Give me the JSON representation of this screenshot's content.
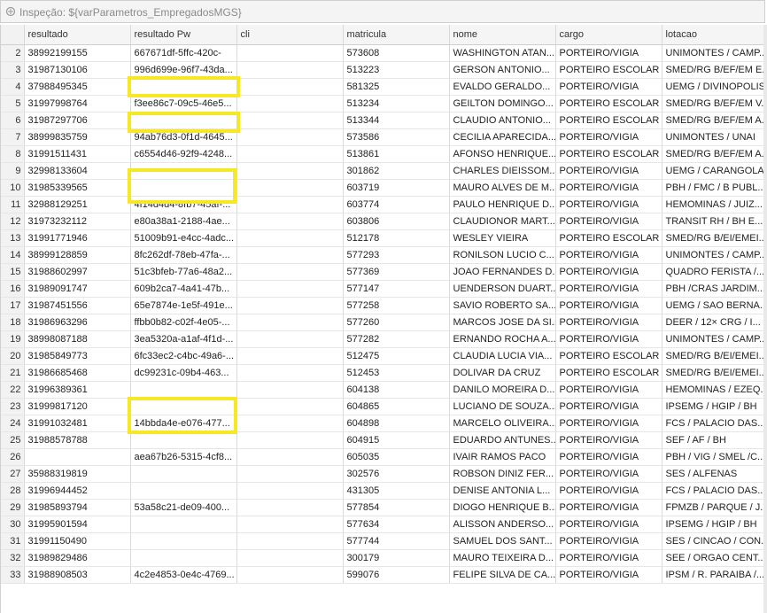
{
  "window": {
    "title": "Inspeção: ${varParametros_EmpregadosMGS}"
  },
  "columns": [
    "",
    "resultado",
    "resultado Pw",
    "cli",
    "matricula",
    "nome",
    "cargo",
    "lotacao"
  ],
  "rows": [
    [
      "2",
      "38992199155",
      "667671df-5ffc-420c-",
      "",
      "573608",
      "WASHINGTON ATAN...",
      "PORTEIRO/VIGIA",
      "UNIMONTES / CAMP..."
    ],
    [
      "3",
      "31987130106",
      "996d699e-96f7-43da...",
      "",
      "513223",
      "GERSON ANTONIO...",
      "PORTEIRO ESCOLAR",
      "SMED/RG B/EF/EM E..."
    ],
    [
      "4",
      "37988495345",
      "",
      "",
      "581325",
      "EVALDO GERALDO...",
      "PORTEIRO/VIGIA",
      "UEMG / DIVINOPOLIS"
    ],
    [
      "5",
      "31997998764",
      "f3ee86c7-09c5-46e5...",
      "",
      "513234",
      "GEILTON DOMINGO...",
      "PORTEIRO ESCOLAR",
      "SMED/RG B/EF/EM V..."
    ],
    [
      "6",
      "31987297706",
      "",
      "",
      "513344",
      "CLAUDIO ANTONIO...",
      "PORTEIRO ESCOLAR",
      "SMED/RG B/EF/EM A..."
    ],
    [
      "7",
      "38999835759",
      "94ab76d3-0f1d-4645...",
      "",
      "573586",
      "CECILIA APARECIDA...",
      "PORTEIRO/VIGIA",
      "UNIMONTES / UNAI"
    ],
    [
      "8",
      "31991511431",
      "c6554d46-92f9-4248...",
      "",
      "513861",
      "AFONSO HENRIQUE...",
      "PORTEIRO ESCOLAR",
      "SMED/RG B/EF/EM A..."
    ],
    [
      "9",
      "32998133604",
      "",
      "",
      "301862",
      "CHARLES DIEISSOM...",
      "PORTEIRO/VIGIA",
      "UEMG / CARANGOLA"
    ],
    [
      "10",
      "31985339565",
      "",
      "",
      "603719",
      "MAURO ALVES DE M...",
      "PORTEIRO/VIGIA",
      "PBH / FMC / B PUBL..."
    ],
    [
      "11",
      "32988129251",
      "4f14d4d4-8fb7-45af-...",
      "",
      "603774",
      "PAULO HENRIQUE D...",
      "PORTEIRO/VIGIA",
      "HEMOMINAS / JUIZ..."
    ],
    [
      "12",
      "31973232112",
      "e80a38a1-2188-4ae...",
      "",
      "603806",
      "CLAUDIONOR MART...",
      "PORTEIRO/VIGIA",
      "TRANSIT RH / BH E..."
    ],
    [
      "13",
      "31991771946",
      "51009b91-e4cc-4adc...",
      "",
      "512178",
      "WESLEY VIEIRA",
      "PORTEIRO ESCOLAR",
      "SMED/RG B/EI/EMEI..."
    ],
    [
      "14",
      "38999128859",
      "8fc262df-78eb-47fa-...",
      "",
      "577293",
      "RONILSON LUCIO C...",
      "PORTEIRO/VIGIA",
      "UNIMONTES / CAMP..."
    ],
    [
      "15",
      "31988602997",
      "51c3bfeb-77a6-48a2...",
      "",
      "577369",
      "JOAO FERNANDES D...",
      "PORTEIRO/VIGIA",
      "QUADRO FERISTA /..."
    ],
    [
      "16",
      "31989091747",
      "609b2ca7-4a41-47b...",
      "",
      "577147",
      "UENDERSON DUART...",
      "PORTEIRO/VIGIA",
      "PBH /CRAS JARDIM..."
    ],
    [
      "17",
      "31987451556",
      "65e7874e-1e5f-491e...",
      "",
      "577258",
      "SAVIO ROBERTO SA...",
      "PORTEIRO/VIGIA",
      "UEMG / SAO BERNA..."
    ],
    [
      "18",
      "31986963296",
      "ffbb0b82-c02f-4e05-...",
      "",
      "577260",
      "MARCOS JOSE DA SI...",
      "PORTEIRO/VIGIA",
      "DEER / 12× CRG / I..."
    ],
    [
      "19",
      "38998087188",
      "3ea5320a-a1af-4f1d-...",
      "",
      "577282",
      "ERNANDO ROCHA A...",
      "PORTEIRO/VIGIA",
      "UNIMONTES / CAMP..."
    ],
    [
      "20",
      "31985849773",
      "6fc33ec2-c4bc-49a6-...",
      "",
      "512475",
      "CLAUDIA LUCIA VIA...",
      "PORTEIRO ESCOLAR",
      "SMED/RG B/EI/EMEI..."
    ],
    [
      "21",
      "31986685468",
      "dc99231c-09b4-463...",
      "",
      "512453",
      "DOLIVAR DA CRUZ",
      "PORTEIRO ESCOLAR",
      "SMED/RG B/EI/EMEI..."
    ],
    [
      "22",
      "31996389361",
      "",
      "",
      "604138",
      "DANILO MOREIRA D...",
      "PORTEIRO/VIGIA",
      "HEMOMINAS / EZEQ..."
    ],
    [
      "23",
      "31999817120",
      "",
      "",
      "604865",
      "LUCIANO DE SOUZA...",
      "PORTEIRO/VIGIA",
      "IPSEMG / HGIP / BH"
    ],
    [
      "24",
      "31991032481",
      "14bbda4e-e076-477...",
      "",
      "604898",
      "MARCELO OLIVEIRA...",
      "PORTEIRO/VIGIA",
      "FCS / PALACIO DAS..."
    ],
    [
      "25",
      "31988578788",
      "",
      "",
      "604915",
      "EDUARDO ANTUNES...",
      "PORTEIRO/VIGIA",
      "SEF / AF / BH"
    ],
    [
      "26",
      "",
      "aea67b26-5315-4cf8...",
      "",
      "605035",
      "IVAIR RAMOS PACO",
      "PORTEIRO/VIGIA",
      "PBH / VIG / SMEL /C..."
    ],
    [
      "27",
      "35988319819",
      "",
      "",
      "302576",
      "ROBSON DINIZ FER...",
      "PORTEIRO/VIGIA",
      "SES / ALFENAS"
    ],
    [
      "28",
      "31996944452",
      "",
      "",
      "431305",
      "DENISE ANTONIA L...",
      "PORTEIRO/VIGIA",
      "FCS / PALACIO DAS..."
    ],
    [
      "29",
      "31985893794",
      "53a58c21-de09-400...",
      "",
      "577854",
      "DIOGO HENRIQUE B...",
      "PORTEIRO/VIGIA",
      "FPMZB / PARQUE / J..."
    ],
    [
      "30",
      "31995901594",
      "",
      "",
      "577634",
      "ALISSON ANDERSO...",
      "PORTEIRO/VIGIA",
      "IPSEMG / HGIP / BH"
    ],
    [
      "31",
      "31991150490",
      "",
      "",
      "577744",
      "SAMUEL DOS SANT...",
      "PORTEIRO/VIGIA",
      "SES / CINCAO / CON..."
    ],
    [
      "32",
      "31989829486",
      "",
      "",
      "300179",
      "MAURO TEIXEIRA D...",
      "PORTEIRO/VIGIA",
      "SEE / ORGAO CENT..."
    ],
    [
      "33",
      "31988908503",
      "4c2e4853-0e4c-4769...",
      "",
      "599076",
      "FELIPE SILVA DE CA...",
      "PORTEIRO/VIGIA",
      "IPSM / R. PARAIBA /..."
    ]
  ],
  "highlight_color": "#f7e825",
  "icons": {
    "title_icon": "inspect-icon"
  }
}
